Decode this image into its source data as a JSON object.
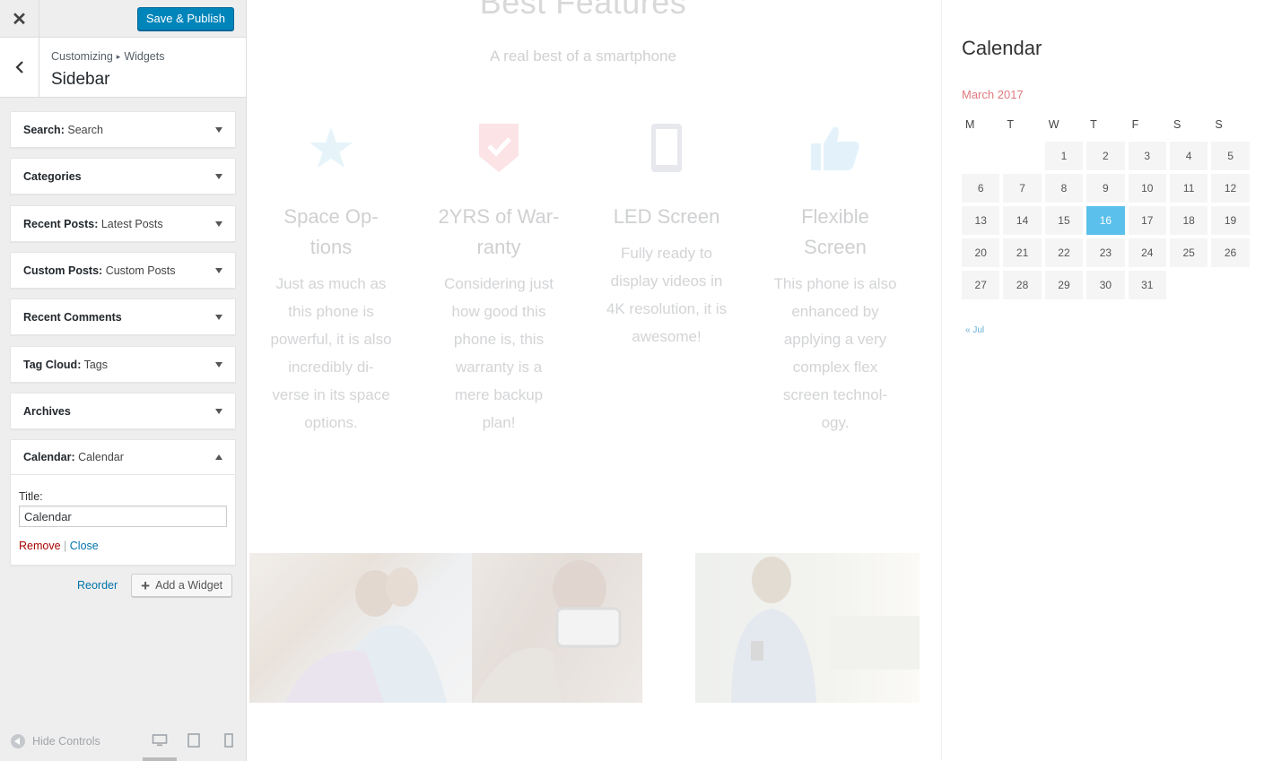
{
  "customizer": {
    "save_label": "Save & Publish",
    "breadcrumb": {
      "root": "Customizing",
      "child": "Widgets"
    },
    "section_title": "Sidebar",
    "widgets": [
      {
        "name": "Search",
        "sep": ":",
        "subtitle": "Search"
      },
      {
        "name": "Categories",
        "sep": "",
        "subtitle": ""
      },
      {
        "name": "Recent Posts",
        "sep": ":",
        "subtitle": "Latest Posts"
      },
      {
        "name": "Custom Posts",
        "sep": ":",
        "subtitle": "Custom Posts"
      },
      {
        "name": "Recent Comments",
        "sep": "",
        "subtitle": ""
      },
      {
        "name": "Tag Cloud",
        "sep": ":",
        "subtitle": "Tags"
      },
      {
        "name": "Archives",
        "sep": "",
        "subtitle": ""
      },
      {
        "name": "Calendar",
        "sep": ":",
        "subtitle": "Calendar"
      }
    ],
    "open_widget": {
      "title_label": "Title:",
      "title_value": "Calendar",
      "remove_label": "Remove",
      "separator": "|",
      "close_label": "Close"
    },
    "reorder_label": "Reorder",
    "add_widget_label": "Add a Widget",
    "hide_controls_label": "Hide Controls"
  },
  "preview": {
    "heading": "Best Features",
    "subheading": "A real best of a smartphone",
    "features": [
      {
        "title": "Space Op-\ntions",
        "desc": "Just as much as\nthis phone is\npowerful, it is also\nincredibly di-\nverse in its space\noptions.",
        "icon": "star-icon",
        "color": "#e6f4fa"
      },
      {
        "title": "2YRS of War-\nranty",
        "desc": "Considering just\nhow good this\nphone is, this\nwarranty is a\nmere backup\nplan!",
        "icon": "shield-check-icon",
        "color": "#fbe3e6"
      },
      {
        "title": "LED Screen",
        "desc": "Fully ready to\ndisplay videos in\n4K resolution, it is\nawesome!",
        "icon": "tablet-icon",
        "color": "#e6e8ee"
      },
      {
        "title": "Flexible\nScreen",
        "desc": "This phone is also\nenhanced by\napplying a very\ncomplex flex\nscreen technol-\nogy.",
        "icon": "thumbs-up-icon",
        "color": "#e3f2fa"
      }
    ],
    "calendar": {
      "title": "Calendar",
      "caption": "March 2017",
      "weekdays": [
        "M",
        "T",
        "W",
        "T",
        "F",
        "S",
        "S"
      ],
      "weeks": [
        [
          "",
          "",
          "1",
          "2",
          "3",
          "4",
          "5"
        ],
        [
          "6",
          "7",
          "8",
          "9",
          "10",
          "11",
          "12"
        ],
        [
          "13",
          "14",
          "15",
          "16",
          "17",
          "18",
          "19"
        ],
        [
          "20",
          "21",
          "22",
          "23",
          "24",
          "25",
          "26"
        ],
        [
          "27",
          "28",
          "29",
          "30",
          "31",
          "",
          ""
        ]
      ],
      "today": "16",
      "prev_link": "« Jul",
      "today_color": "#5bc0eb",
      "caption_color": "#e0797f"
    }
  }
}
